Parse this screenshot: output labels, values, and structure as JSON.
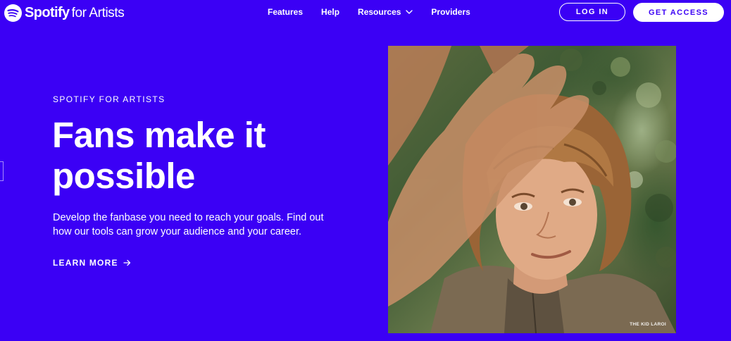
{
  "brand": {
    "name": "Spotify",
    "suffix": "for Artists",
    "colors": {
      "background": "#3b00f5",
      "text": "#ffffff",
      "button_text": "#3b00f5"
    }
  },
  "nav": {
    "links": [
      {
        "label": "Features"
      },
      {
        "label": "Help"
      },
      {
        "label": "Resources",
        "icon": "chevron-down-icon"
      },
      {
        "label": "Providers"
      }
    ],
    "login_label": "LOG IN",
    "access_label": "GET ACCESS"
  },
  "hero": {
    "eyebrow": "SPOTIFY FOR ARTISTS",
    "headline_line1": "Fans make it",
    "headline_line2": "possible",
    "subtext": "Develop the fanbase you need to reach your goals. Find out how our tools can grow your audience and your career.",
    "cta_label": "LEARN MORE",
    "cta_icon": "arrow-right-icon"
  },
  "photo": {
    "caption": "THE KID LAROI"
  }
}
